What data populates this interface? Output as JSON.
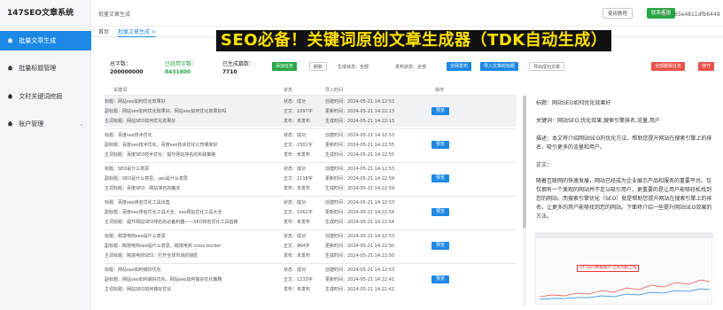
{
  "app_title": "147SEO文章系统",
  "sidebar": {
    "items": [
      {
        "label": "批量文章生成",
        "active": true
      },
      {
        "label": "批量标题管理",
        "active": false
      },
      {
        "label": "文时关键词挖掘",
        "active": false
      },
      {
        "label": "账户管理",
        "active": false
      }
    ]
  },
  "topbar": {
    "page_title": "批量文章生成",
    "help_label": "使用教程",
    "pay_label": "联系客服",
    "user": "65e4811dfb6449"
  },
  "tabs": [
    {
      "label": "首页",
      "active": false
    },
    {
      "label": "批量文章生成 ×",
      "active": true
    }
  ],
  "banner": "SEO必备！关键词原创文章生成器（TDK自动生成）",
  "stats": {
    "total_label": "总字数：",
    "total_value": "200000000",
    "used_label": "已经用字数：",
    "used_value": "8431800",
    "generated_label": "已生成篇数：",
    "generated_value": "7710"
  },
  "actions": {
    "add_label": "添加任务",
    "refresh_label": "刷新",
    "gen_status": "生成状态：全部",
    "pub_status": "发布状态：全部",
    "batch_label": "全网发布",
    "import_label": "导入文章的标题",
    "export_label": "导出成功文章",
    "delete_label": "全部删除任务",
    "stop_label": "停守"
  },
  "table": {
    "headers": [
      "关键词",
      "状态",
      "导入时间",
      "操作"
    ],
    "op_label": "预览",
    "rows": [
      {
        "title": "标题：网站seo如何优化效果好",
        "sub": "副标题：网站seo如何优化效果好，网站seo如何优化效果好吗",
        "kw": "主词标题：网站SEO如何优化效果好",
        "s1": "状态：成功",
        "s2": "正文：1097字",
        "s3": "发布：未发布",
        "t1": "创建时间：2024-05-21 14:12:53",
        "t2": "更新时间：2024-05-21 14:22:13",
        "t3": "生成时间：2024-05-21 14:22:13"
      },
      {
        "title": "标题：百度seo技术优化",
        "sub": "副标题：百度seo技术优化，百度seo技术优化公司哪家好",
        "kw": "主词标题：百度SEO技术优化：提升网站排名的实践策略",
        "s1": "状态：成功",
        "s2": "正文：2301字",
        "s3": "发布：未发布",
        "t1": "创建时间：2024-05-21 14:12:53",
        "t2": "更新时间：2024-05-21 14:22:55",
        "t3": "生成时间：2024-05-21 14:22:55"
      },
      {
        "title": "标题：SEO是什么意思",
        "sub": "副标题：SEO是什么意思，seo是什么意思",
        "kw": "主词标题：百度SEO：网站排名的魔法",
        "s1": "状态：成功",
        "s2": "正文：1118字",
        "s3": "发布：未发布",
        "t1": "创建时间：2024-05-21 14:12:53",
        "t2": "更新时间：2024-05-21 14:22:59",
        "t3": "生成时间：2024-05-21 14:22:59"
      },
      {
        "title": "标题：百度seo排名优化工具出售",
        "sub": "副标题：百度seo排名优化工具大全，seo网站优化工具大全",
        "kw": "主词标题：提升网站SEO排名的必备利器——SEO排名优化工具指南",
        "s1": "状态：成功",
        "s2": "正文：1062字",
        "s3": "发布：未发布",
        "t1": "创建时间：2024-05-21 14:12:53",
        "t2": "更新时间：2024-05-21 14:22:54",
        "t3": "生成时间：2024-05-21 14:22:54"
      },
      {
        "title": "标题：跨境电商seo是什么意思",
        "sub": "副标题：跨境电商seo是什么意思，跨境电商 cross border",
        "kw": "主词标题：跨境电商SEO：打开全球市场的钥匙",
        "s1": "状态：成功",
        "s2": "正文：964字",
        "s3": "发布：未发布",
        "t1": "创建时间：2024-05-21 14:12:53",
        "t2": "更新时间：2024-05-21 14:22:50",
        "t3": "生成时间：2024-05-21 14:22:50"
      },
      {
        "title": "标题：网站seo如何做好优化",
        "sub": "副标题：网站seo如何做好优化，网站seo如何做好优化策略",
        "kw": "主词标题：网站SEO如何做好优化",
        "s1": "状态：成功",
        "s2": "正文：1233字",
        "s3": "发布：未发布",
        "t1": "创建时间：2024-05-21 14:12:53",
        "t2": "更新时间：2024-05-21 14:22:41",
        "t3": "生成时间：2024-05-21 14:22:41"
      }
    ]
  },
  "preview": {
    "title": "标题：网站SEO如何优化效果好",
    "keywords": "关键词：网站SEO,优化效果,搜索引擎排名,流量,用户",
    "description": "描述：本文将介绍网站SEO的优化方法，帮助您提升网站在搜索引擎上的排名，吸引更多的流量和用户。",
    "body_label": "正文：",
    "paragraph": "随着互联网的快速发展，网站已经成为企业展示产品和服务的重要平台。仅仅拥有一个美观的网站并不足以吸引用户，更重要的是让用户能够轻松找到您的网站。而搜索引擎优化（SEO）就是帮助您提升网站在搜索引擎上的排名，让更多的用户能够找到您的网站。下面将介绍一些提升网站SEO效果的方法。",
    "image_tag": "147SEO数据展示 全新功能上线"
  },
  "colors": {
    "primary": "#1e88e5",
    "success": "#28a745",
    "danger": "#e8524a",
    "banner_text": "#ffe100"
  }
}
